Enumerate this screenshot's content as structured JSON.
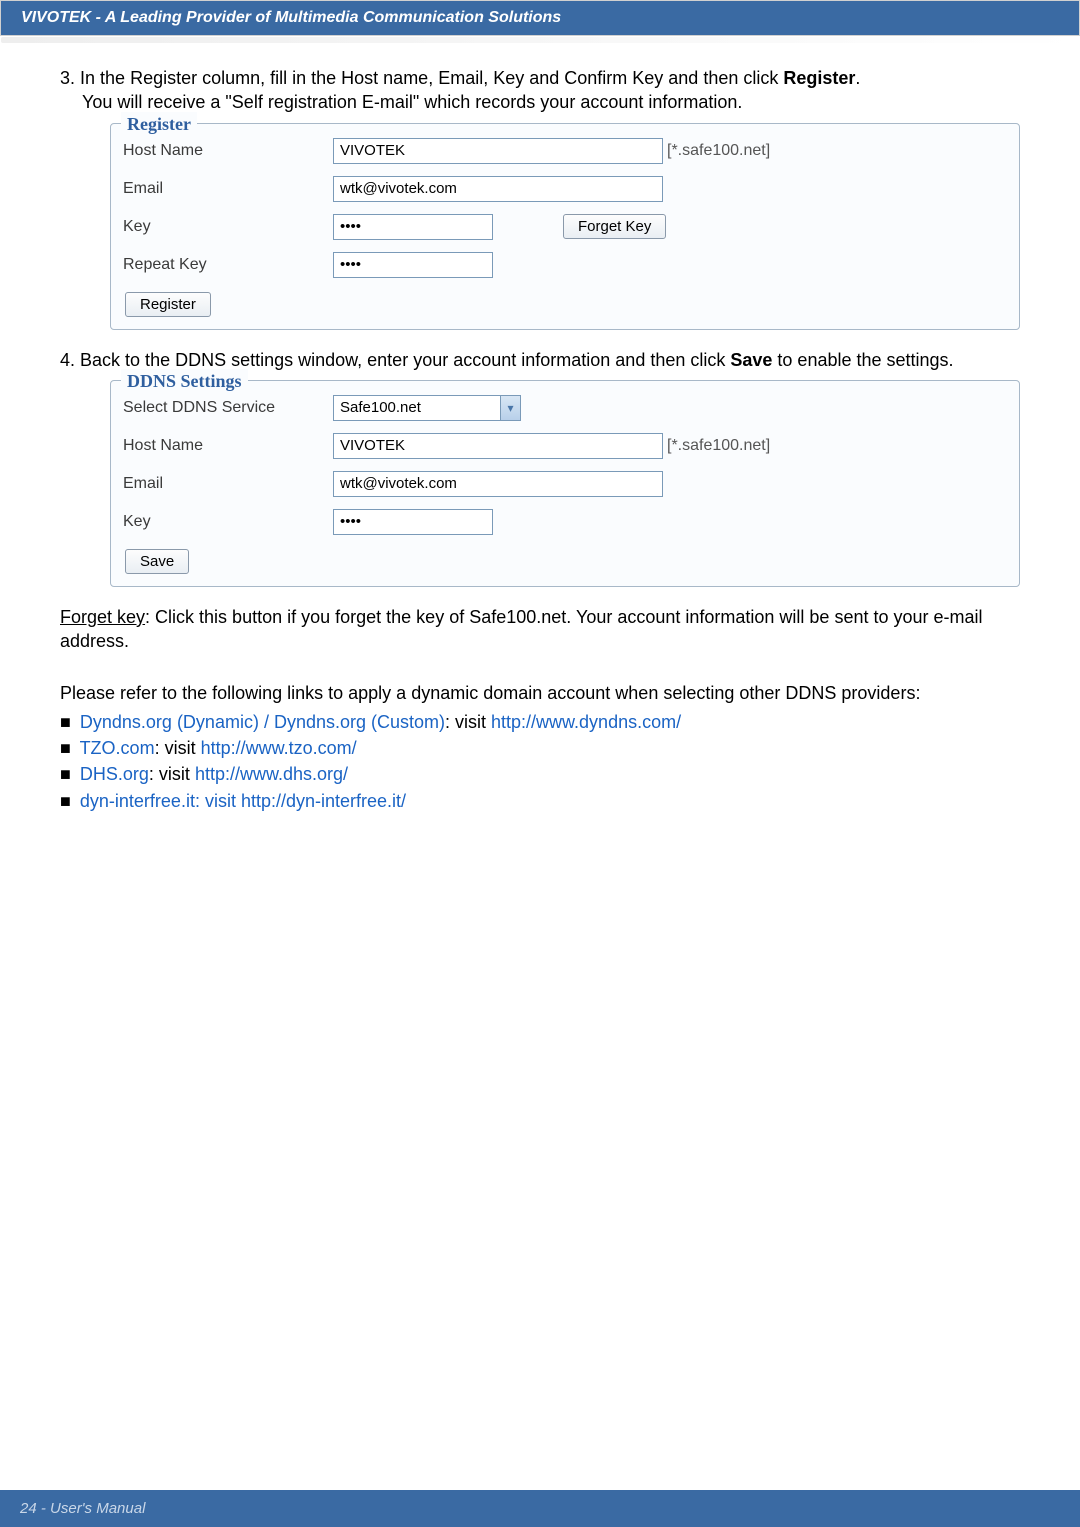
{
  "header": {
    "title": "VIVOTEK - A Leading Provider of Multimedia Communication Solutions"
  },
  "step3": {
    "num": "3.",
    "text_main": "In the Register column, fill in the Host name, Email, Key and Confirm Key and then click ",
    "text_bold": "Register",
    "text_tail": ".",
    "sub": "You will receive a \"Self registration E-mail\" which records your account information."
  },
  "register_box": {
    "legend": "Register",
    "host_label": "Host Name",
    "host_value": "VIVOTEK",
    "host_suffix": "[*.safe100.net]",
    "email_label": "Email",
    "email_value": "wtk@vivotek.com",
    "key_label": "Key",
    "key_value": "••••",
    "forget_btn": "Forget Key",
    "repeat_label": "Repeat Key",
    "repeat_value": "••••",
    "register_btn": "Register"
  },
  "step4": {
    "num": "4.",
    "text_main": "Back to the DDNS settings window, enter your account information and then click ",
    "text_bold": "Save",
    "text_tail": " to enable the settings."
  },
  "ddns_box": {
    "legend": "DDNS Settings",
    "select_label": "Select DDNS Service",
    "select_value": "Safe100.net",
    "host_label": "Host Name",
    "host_value": "VIVOTEK",
    "host_suffix": "[*.safe100.net]",
    "email_label": "Email",
    "email_value": "wtk@vivotek.com",
    "key_label": "Key",
    "key_value": "••••",
    "save_btn": "Save"
  },
  "forget_note": {
    "lead": "Forget key",
    "rest": ": Click this button if you forget the key of Safe100.net. Your account information will be sent to your e-mail address."
  },
  "links": {
    "intro": "Please refer to the following links to apply a dynamic domain account when selecting other DDNS providers:",
    "bullet": "■",
    "items": [
      {
        "name": "Dyndns.org (Dynamic) / Dyndns.org (Custom)",
        "mid": ": visit ",
        "url": "http://www.dyndns.com/"
      },
      {
        "name": "TZO.com",
        "mid": ": visit ",
        "url": "http://www.tzo.com/"
      },
      {
        "name": "DHS.org",
        "mid": ": visit ",
        "url": "http://www.dhs.org/"
      },
      {
        "name": "dyn-interfree.it",
        "mid": ": visit ",
        "url": "http://dyn-interfree.it/",
        "blue_mid": true
      }
    ]
  },
  "footer": {
    "text": "24 - User's Manual"
  }
}
